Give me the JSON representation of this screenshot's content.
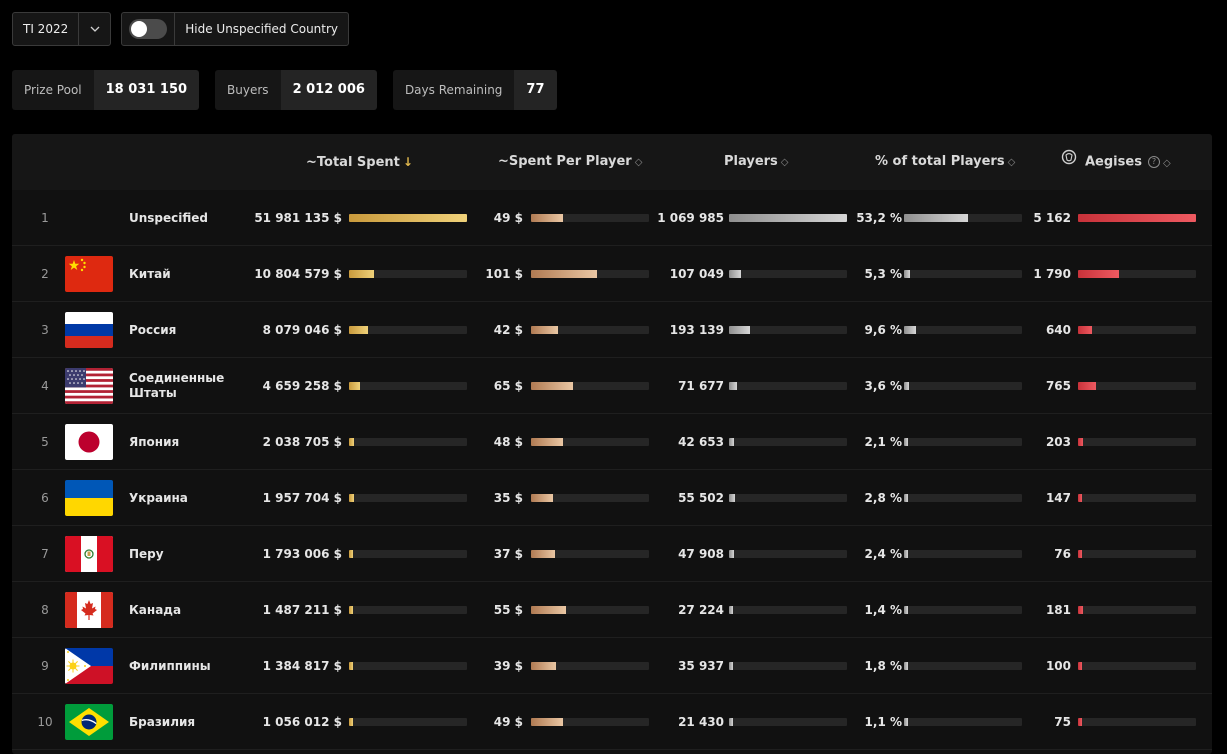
{
  "filters": {
    "event": "TI 2022",
    "toggle_label": "Hide Unspecified Country",
    "toggle_on": false
  },
  "stats": [
    {
      "label": "Prize Pool",
      "value": "18 031 150"
    },
    {
      "label": "Buyers",
      "value": "2 012 006"
    },
    {
      "label": "Days Remaining",
      "value": "77"
    }
  ],
  "columns": {
    "total_spent": "~Total Spent",
    "spent_per_player": "~Spent Per Player",
    "players": "Players",
    "pct_players": "% of total Players",
    "aegises": "Aegises"
  },
  "colors": {
    "total_spent": "#e0b84e",
    "spent_per_player": "#d9a883",
    "players": "#c4c4c4",
    "pct_players": "#c4c4c4",
    "aegises": "#e0464d"
  },
  "rows": [
    {
      "rank": "1",
      "flag": "",
      "country": "Unspecified",
      "total": "51 981 135 $",
      "total_f": 1.0,
      "per": "49 $",
      "per_f": 0.27,
      "players": "1 069 985",
      "players_f": 1.0,
      "pct": "53,2 %",
      "pct_f": 0.54,
      "aegis": "5 162",
      "aegis_f": 1.0
    },
    {
      "rank": "2",
      "flag": "cn",
      "country": "Китай",
      "total": "10 804 579 $",
      "total_f": 0.21,
      "per": "101 $",
      "per_f": 0.56,
      "players": "107 049",
      "players_f": 0.1,
      "pct": "5,3 %",
      "pct_f": 0.05,
      "aegis": "1 790",
      "aegis_f": 0.35
    },
    {
      "rank": "3",
      "flag": "ru",
      "country": "Россия",
      "total": "8 079 046 $",
      "total_f": 0.16,
      "per": "42 $",
      "per_f": 0.23,
      "players": "193 139",
      "players_f": 0.18,
      "pct": "9,6 %",
      "pct_f": 0.1,
      "aegis": "640",
      "aegis_f": 0.12
    },
    {
      "rank": "4",
      "flag": "us",
      "country": "Соединенные Штаты",
      "total": "4 659 258 $",
      "total_f": 0.09,
      "per": "65 $",
      "per_f": 0.36,
      "players": "71 677",
      "players_f": 0.07,
      "pct": "3,6 %",
      "pct_f": 0.04,
      "aegis": "765",
      "aegis_f": 0.15
    },
    {
      "rank": "5",
      "flag": "jp",
      "country": "Япония",
      "total": "2 038 705 $",
      "total_f": 0.04,
      "per": "48 $",
      "per_f": 0.27,
      "players": "42 653",
      "players_f": 0.04,
      "pct": "2,1 %",
      "pct_f": 0.02,
      "aegis": "203",
      "aegis_f": 0.04
    },
    {
      "rank": "6",
      "flag": "ua",
      "country": "Украина",
      "total": "1 957 704 $",
      "total_f": 0.04,
      "per": "35 $",
      "per_f": 0.19,
      "players": "55 502",
      "players_f": 0.05,
      "pct": "2,8 %",
      "pct_f": 0.03,
      "aegis": "147",
      "aegis_f": 0.03
    },
    {
      "rank": "7",
      "flag": "pe",
      "country": "Перу",
      "total": "1 793 006 $",
      "total_f": 0.03,
      "per": "37 $",
      "per_f": 0.2,
      "players": "47 908",
      "players_f": 0.04,
      "pct": "2,4 %",
      "pct_f": 0.02,
      "aegis": "76",
      "aegis_f": 0.01
    },
    {
      "rank": "8",
      "flag": "ca",
      "country": "Канада",
      "total": "1 487 211 $",
      "total_f": 0.03,
      "per": "55 $",
      "per_f": 0.3,
      "players": "27 224",
      "players_f": 0.03,
      "pct": "1,4 %",
      "pct_f": 0.01,
      "aegis": "181",
      "aegis_f": 0.04
    },
    {
      "rank": "9",
      "flag": "ph",
      "country": "Филиппины",
      "total": "1 384 817 $",
      "total_f": 0.03,
      "per": "39 $",
      "per_f": 0.21,
      "players": "35 937",
      "players_f": 0.03,
      "pct": "1,8 %",
      "pct_f": 0.02,
      "aegis": "100",
      "aegis_f": 0.02
    },
    {
      "rank": "10",
      "flag": "br",
      "country": "Бразилия",
      "total": "1 056 012 $",
      "total_f": 0.02,
      "per": "49 $",
      "per_f": 0.27,
      "players": "21 430",
      "players_f": 0.02,
      "pct": "1,1 %",
      "pct_f": 0.01,
      "aegis": "75",
      "aegis_f": 0.01
    }
  ]
}
